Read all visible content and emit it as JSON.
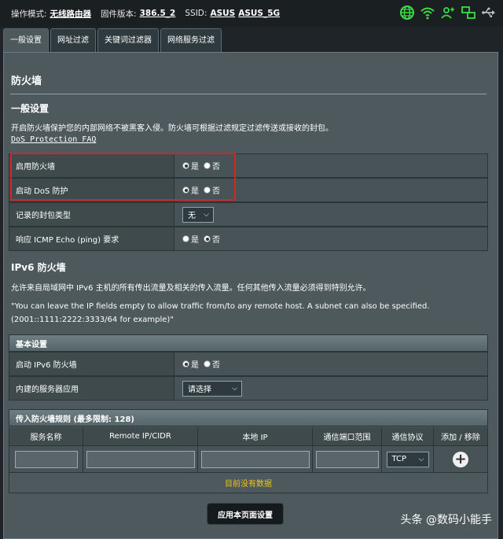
{
  "topbar": {
    "mode_label": "操作模式:",
    "mode_value": "无线路由器",
    "firmware_label": "固件版本:",
    "firmware_value": "386.5_2",
    "ssid_label": "SSID:",
    "ssid_1": "ASUS",
    "ssid_2": "ASUS_5G"
  },
  "tabs": [
    {
      "label": "一般设置"
    },
    {
      "label": "网址过滤"
    },
    {
      "label": "关键词过滤器"
    },
    {
      "label": "网络服务过滤"
    }
  ],
  "page_title": "防火墙",
  "general": {
    "heading": "一般设置",
    "description": "开启防火墙保护您的内部网络不被黑客入侵。防火墙可根据过滤规定过滤传送或接收的封包。",
    "faq_link": "DoS Protection FAQ",
    "rows": [
      {
        "label": "启用防火墙",
        "yes": "是",
        "no": "否"
      },
      {
        "label": "启动 DoS 防护",
        "yes": "是",
        "no": "否"
      },
      {
        "label": "记录的封包类型",
        "select": "无"
      },
      {
        "label": "响应 ICMP Echo (ping) 要求",
        "yes": "是",
        "no": "否"
      }
    ]
  },
  "ipv6": {
    "heading": "IPv6 防火墙",
    "description": "允许来自局域网中 IPv6 主机的所有传出流量及相关的传入流量。任何其他传入流量必须得到特别允许。",
    "note_1": "\"You can leave the IP fields empty to allow traffic from/to any remote host. A subnet can also be specified.",
    "note_2": "(2001::1111:2222:3333/64 for example)\"",
    "basic_heading": "基本设置",
    "rows": [
      {
        "label": "启动 IPv6 防火墙",
        "yes": "是",
        "no": "否"
      },
      {
        "label": "内建的服务器应用",
        "select": "请选择"
      }
    ]
  },
  "rules": {
    "heading": "传入防火墙规则 (最多限制: 128)",
    "columns": [
      "服务名称",
      "Remote IP/CIDR",
      "本地 IP",
      "通信端口范围",
      "通信协议",
      "添加 / 移除"
    ],
    "protocol": "TCP",
    "empty_text": "目前没有数据"
  },
  "apply_button": "应用本页面设置",
  "watermark": "头条 @数码小能手",
  "colors": {
    "highlight": "#d6232a",
    "empty_text": "#f3c418",
    "icon_green": "#3ddc43"
  }
}
